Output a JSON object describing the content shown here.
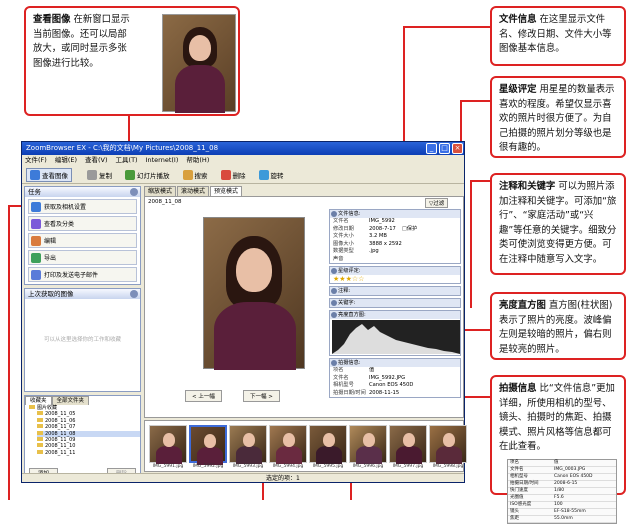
{
  "callouts": {
    "view_image": {
      "title": "查看图像",
      "text": "在新窗口显示当前图像。还可以局部放大，或同时显示多张图像进行比较。"
    },
    "file_info": {
      "title": "文件信息",
      "text": "在这里显示文件名、修改日期、文件大小等图像基本信息。"
    },
    "star_rating": {
      "title": "星级评定",
      "text": "用星星的数量表示喜欢的程度。希望仅显示喜欢的照片时很方便了。为自己拍摄的照片划分等级也是很有趣的。"
    },
    "notes_keywords": {
      "title": "注释和关键字",
      "text": "可以为照片添加注释和关键字。可添加“旅行”、“家庭活动”或“兴趣”等任意的关键字。细致分类可使浏览变得更方便。可在注释中随意写入文字。"
    },
    "histogram": {
      "title": "亮度直方图",
      "text": "直方图(柱状图)表示了照片的亮度。波峰偏左则是较暗的照片，偏右则是较亮的照片。"
    },
    "shooting_info": {
      "title": "拍摄信息",
      "text": "比“文件信息”更加详细，所使用相机的型号、镜头、拍摄时的焦距、拍摄模式、照片风格等信息都可在此查看。"
    }
  },
  "window": {
    "title": "ZoomBrowser EX  -  C:\\我的文档\\My Pictures\\2008_11_08",
    "menu": [
      "文件(F)",
      "编辑(E)",
      "查看(V)",
      "工具(T)",
      "Internet(I)",
      "帮助(H)"
    ],
    "toolbar": [
      {
        "label": "查看图像",
        "icon_color": "#3d7bd9",
        "active": true
      },
      {
        "label": "复制",
        "icon_color": "#9a9a9a",
        "active": false
      },
      {
        "label": "幻灯片播放",
        "icon_color": "#4a9a3a",
        "active": false
      },
      {
        "label": "搜索",
        "icon_color": "#d9a03d",
        "active": false
      },
      {
        "label": "删除",
        "icon_color": "#d94a3d",
        "active": false
      },
      {
        "label": "旋转",
        "icon_color": "#3d9ad9",
        "active": false
      }
    ],
    "tasks_title": "任务",
    "tasks": [
      {
        "label": "获取及相机设置",
        "icon_color": "#3d7bd9"
      },
      {
        "label": "查看及分类",
        "icon_color": "#7b5ad9"
      },
      {
        "label": "编辑",
        "icon_color": "#d97b3d"
      },
      {
        "label": "导出",
        "icon_color": "#3da05a"
      },
      {
        "label": "打印及发送电子邮件",
        "icon_color": "#5a7bd9"
      }
    ],
    "recent_title": "上次获取的图像",
    "recent_text": "可以从这里选择你的工作和收藏",
    "folder_tabs": [
      "收藏夹",
      "全部文件夹"
    ],
    "folder_root": "图片收藏",
    "folders": [
      "2008_11_05",
      "2008_11_06",
      "2008_11_07",
      "2008_11_08",
      "2008_11_09",
      "2008_11_10",
      "2008_11_11"
    ],
    "folder_buttons": [
      "添加",
      "删除"
    ],
    "view_tabs": [
      "缩放模式",
      "滚动模式",
      "预览模式"
    ],
    "folder_path": "2008_11_08",
    "filter_label": "过滤",
    "prev_button": "< 上一幅",
    "next_button": "下一幅 >",
    "file_info": {
      "title": "文件信息:",
      "rows": [
        {
          "k": "文件名",
          "v": "IMG_5992"
        },
        {
          "k": "修改日期",
          "v": "2008-7-17"
        },
        {
          "k": "文件大小",
          "v": "3.2 MB"
        },
        {
          "k": "图像大小",
          "v": "3888 x 2592"
        },
        {
          "k": "数据类型",
          "v": ".jpg"
        },
        {
          "k": "声音",
          "v": ""
        }
      ],
      "protect_label": "保护"
    },
    "rating_title": "星级评定:",
    "rating": 3,
    "notes_title": "注释:",
    "keywords_title": "关键字:",
    "histogram_title": "亮度直方图:",
    "shooting_title": "拍摄信息:",
    "shooting_rows": [
      {
        "k": "项名",
        "v": "值"
      },
      {
        "k": "文件名",
        "v": "IMG_5992.JPG"
      },
      {
        "k": "相机型号",
        "v": "Canon EOS 450D"
      },
      {
        "k": "拍摄日期/时间",
        "v": "2008-11-15"
      }
    ],
    "thumbnails": [
      "IMG_5991.jpg",
      "IMG_5992.jpg",
      "IMG_5993.jpg",
      "IMG_5994.jpg",
      "IMG_5995.jpg",
      "IMG_5996.jpg",
      "IMG_5997.jpg",
      "IMG_5998.jpg"
    ],
    "status": "选定的项：1"
  },
  "preview_mini": {
    "rows": [
      {
        "k": "项名",
        "v": "值"
      },
      {
        "k": "文件名",
        "v": "IMG_0003.JPG"
      },
      {
        "k": "相机型号",
        "v": "Canon EOS 450D"
      },
      {
        "k": "拍摄日期/时间",
        "v": "2008-6-15"
      },
      {
        "k": "快门速度",
        "v": "1/80"
      },
      {
        "k": "光圈值",
        "v": "F5.6"
      },
      {
        "k": "ISO感光度",
        "v": "100"
      },
      {
        "k": "镜头",
        "v": "EF-S18-55mm"
      },
      {
        "k": "焦距",
        "v": "55.0mm"
      }
    ]
  }
}
